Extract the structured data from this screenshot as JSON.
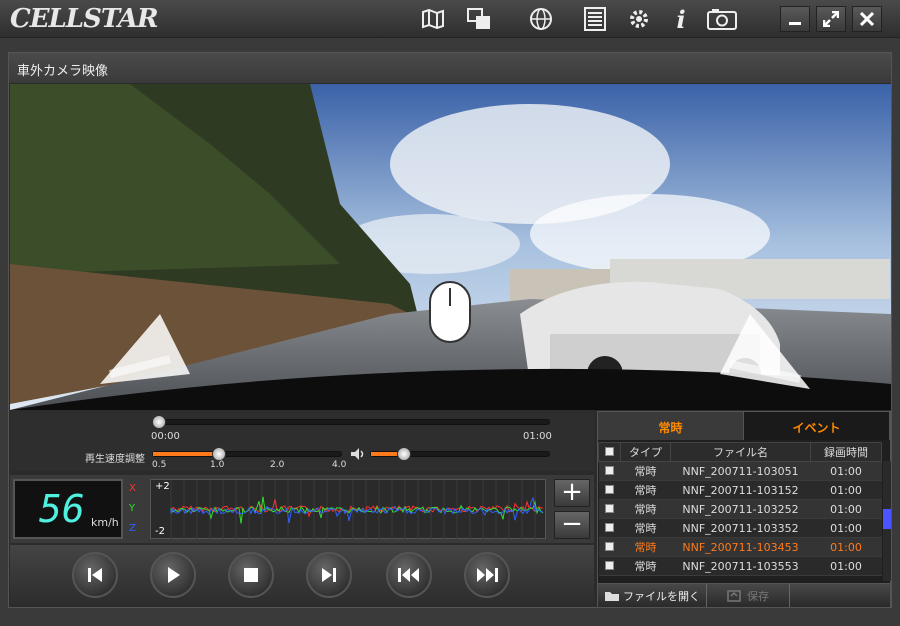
{
  "app": {
    "logo": "CELLSTAR"
  },
  "toolbar": {
    "icons": [
      "map-icon",
      "display-icon",
      "globe-icon",
      "list-icon",
      "gear-icon",
      "info-icon",
      "camera-icon"
    ]
  },
  "window": {
    "minimize": "_",
    "maximize": "⤢",
    "close": "✕"
  },
  "panel": {
    "title": "車外カメラ映像"
  },
  "playback": {
    "elapsed": "00:00",
    "duration": "01:00",
    "progress": 0,
    "speed_label": "再生速度調整",
    "speed_ticks": [
      "0.5",
      "1.0",
      "2.0",
      "4.0"
    ],
    "speed_value": 1.0,
    "volume": 0.15
  },
  "meter": {
    "speed": "56",
    "unit": "km/h",
    "axes": [
      "X",
      "Y",
      "Z"
    ],
    "scale_max": "+2",
    "scale_min": "-2",
    "plus": "+",
    "minus": "−"
  },
  "controls": [
    "skip-start",
    "play",
    "stop",
    "step-forward",
    "rewind",
    "fast-forward"
  ],
  "filelist": {
    "tabs": [
      "常時",
      "イベント"
    ],
    "headers": [
      "タイプ",
      "ファイル名",
      "録画時間"
    ],
    "rows": [
      {
        "type": "常時",
        "name": "NNF_200711-103051",
        "time": "01:00"
      },
      {
        "type": "常時",
        "name": "NNF_200711-103152",
        "time": "01:00"
      },
      {
        "type": "常時",
        "name": "NNF_200711-103252",
        "time": "01:00"
      },
      {
        "type": "常時",
        "name": "NNF_200711-103352",
        "time": "01:00"
      },
      {
        "type": "常時",
        "name": "NNF_200711-103453",
        "time": "01:00"
      },
      {
        "type": "常時",
        "name": "NNF_200711-103553",
        "time": "01:00"
      }
    ],
    "selected_row": 4,
    "open_label": "ファイルを開く",
    "save_label": "保存"
  },
  "colors": {
    "accent": "#ff7a1a",
    "x_axis": "#ff3030",
    "y_axis": "#30e030",
    "z_axis": "#3060ff"
  }
}
